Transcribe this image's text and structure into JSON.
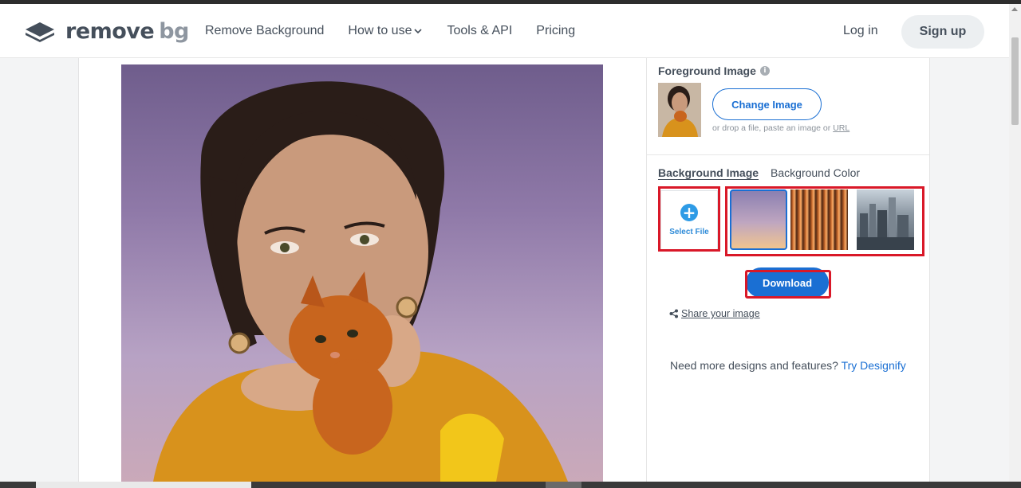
{
  "header": {
    "logo": {
      "name": "remove",
      "suffix": "bg"
    },
    "nav": [
      {
        "label": "Remove Background"
      },
      {
        "label": "How to use"
      },
      {
        "label": "Tools & API"
      },
      {
        "label": "Pricing"
      }
    ],
    "login_label": "Log in",
    "signup_label": "Sign up"
  },
  "sidebar": {
    "foreground_title": "Foreground Image",
    "info_icon": "i",
    "change_image_label": "Change Image",
    "drop_hint": "or drop a file, paste an image or",
    "drop_hint_link": "URL",
    "tabs": [
      {
        "label": "Background Image",
        "active": true
      },
      {
        "label": "Background Color",
        "active": false
      }
    ],
    "select_file_icon": "+",
    "select_file_label": "Select File",
    "backgrounds": [
      {
        "name": "purple-sunset-gradient",
        "selected": true
      },
      {
        "name": "wood-stripes"
      },
      {
        "name": "city-skyline"
      }
    ],
    "download_label": "Download",
    "share_label": "Share your image",
    "more_text": "Need more designs and features?",
    "more_link": "Try Designify"
  },
  "colors": {
    "accent": "#1a6fd3",
    "highlight": "#d91828"
  }
}
